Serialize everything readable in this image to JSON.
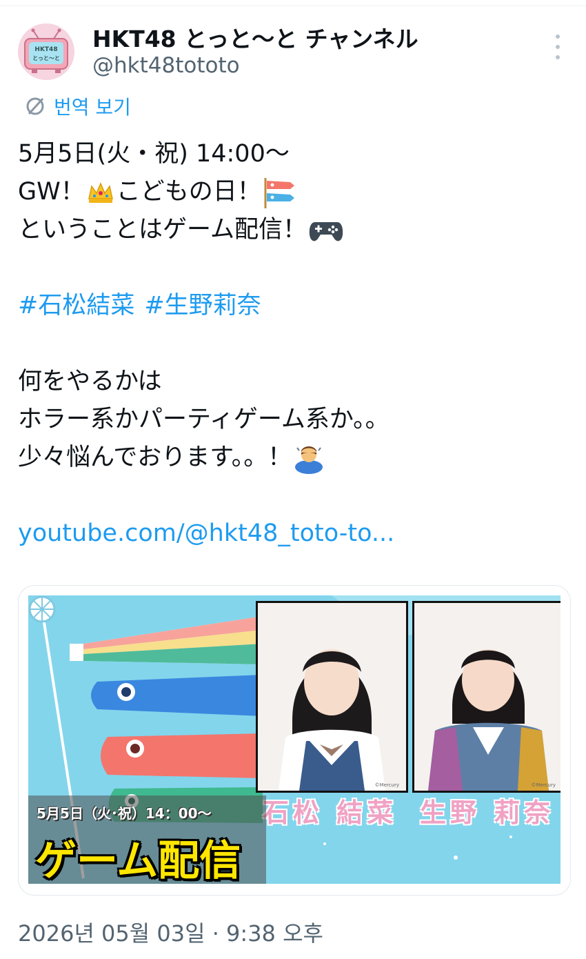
{
  "author": {
    "display_name": "HKT48 とっと〜と チャンネル",
    "handle": "@hkt48tototo",
    "avatar_icon": "tv-logo-icon",
    "avatar_text_top": "HKT48",
    "avatar_text_bottom": "とっと〜と"
  },
  "translate": {
    "label": "번역 보기",
    "icon": "globe-translate-icon"
  },
  "tweet": {
    "line1": "5月5日(火・祝) 14:00〜",
    "line2_a": "GW！",
    "line2_b": "こどもの日！",
    "line3": "ということはゲーム配信！",
    "hashtag1": "#石松結菜",
    "hashtag2": "#生野莉奈",
    "line5": "何をやるかは",
    "line6": "ホラー系かパーティゲーム系か。。",
    "line7": "少々悩んでおります。。！",
    "link": "youtube.com/@hkt48_toto-to..."
  },
  "media": {
    "member1": "石松 結菜",
    "member2": "生野 莉奈",
    "date": "5月5日（火･祝）14：00〜",
    "headline": "ゲーム配信",
    "copyright": "©Mercury"
  },
  "timestamp": "2026년 05월 03일 · 9:38 오후",
  "colors": {
    "link": "#1d9bf0",
    "muted": "#536471",
    "banner_bg": "#7fd3ec",
    "headline": "#ffe600"
  }
}
